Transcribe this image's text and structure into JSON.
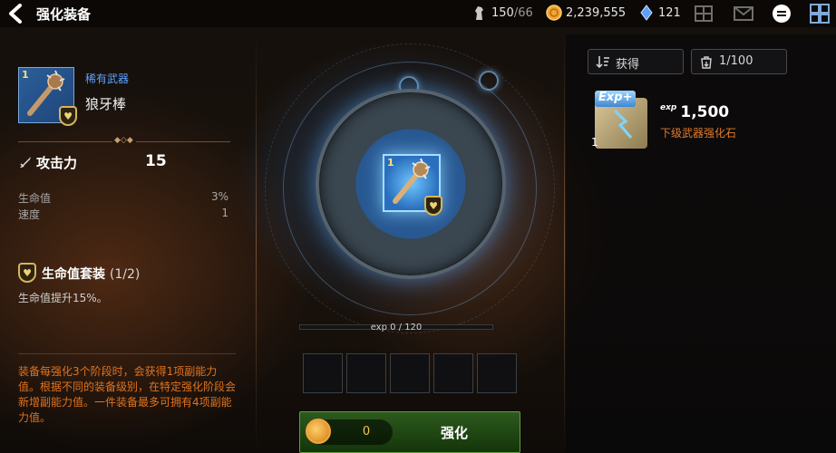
{
  "header": {
    "title": "强化装备",
    "stamina": {
      "current": "150",
      "sub": "/66"
    },
    "gold": "2,239,555",
    "crystal": "121"
  },
  "equipment": {
    "level_badge": "1",
    "rarity": "稀有武器",
    "name": "狼牙棒",
    "attack_label": "攻击力",
    "attack_value": "15",
    "stats": [
      {
        "label": "生命值",
        "value": "3%"
      },
      {
        "label": "速度",
        "value": "1"
      }
    ],
    "set_name": "生命值套装",
    "set_count": "(1/2)",
    "set_desc": "生命值提升15%。",
    "note": "装备每强化3个阶段时，会获得1项副能力值。根据不同的装备级别，在特定强化阶段会新增副能力值。一件装备最多可拥有4项副能力值。"
  },
  "enhance": {
    "item_level": "1",
    "exp_text": "exp 0 / 120",
    "exp_fraction": 0,
    "cost": "0",
    "button_label": "强化",
    "slots": 5
  },
  "materials": {
    "sort_label": "获得",
    "filter_label": "1/100",
    "items": [
      {
        "badge": "Exp+",
        "count": "1",
        "exp_tag": "exp",
        "exp_value": "1,500",
        "name": "下级武器强化石"
      }
    ]
  },
  "colors": {
    "rarity_blue": "#5da1ff",
    "note_orange": "#e0731f",
    "button_green": "#2c5a1e",
    "gold": "#f0c64a"
  }
}
